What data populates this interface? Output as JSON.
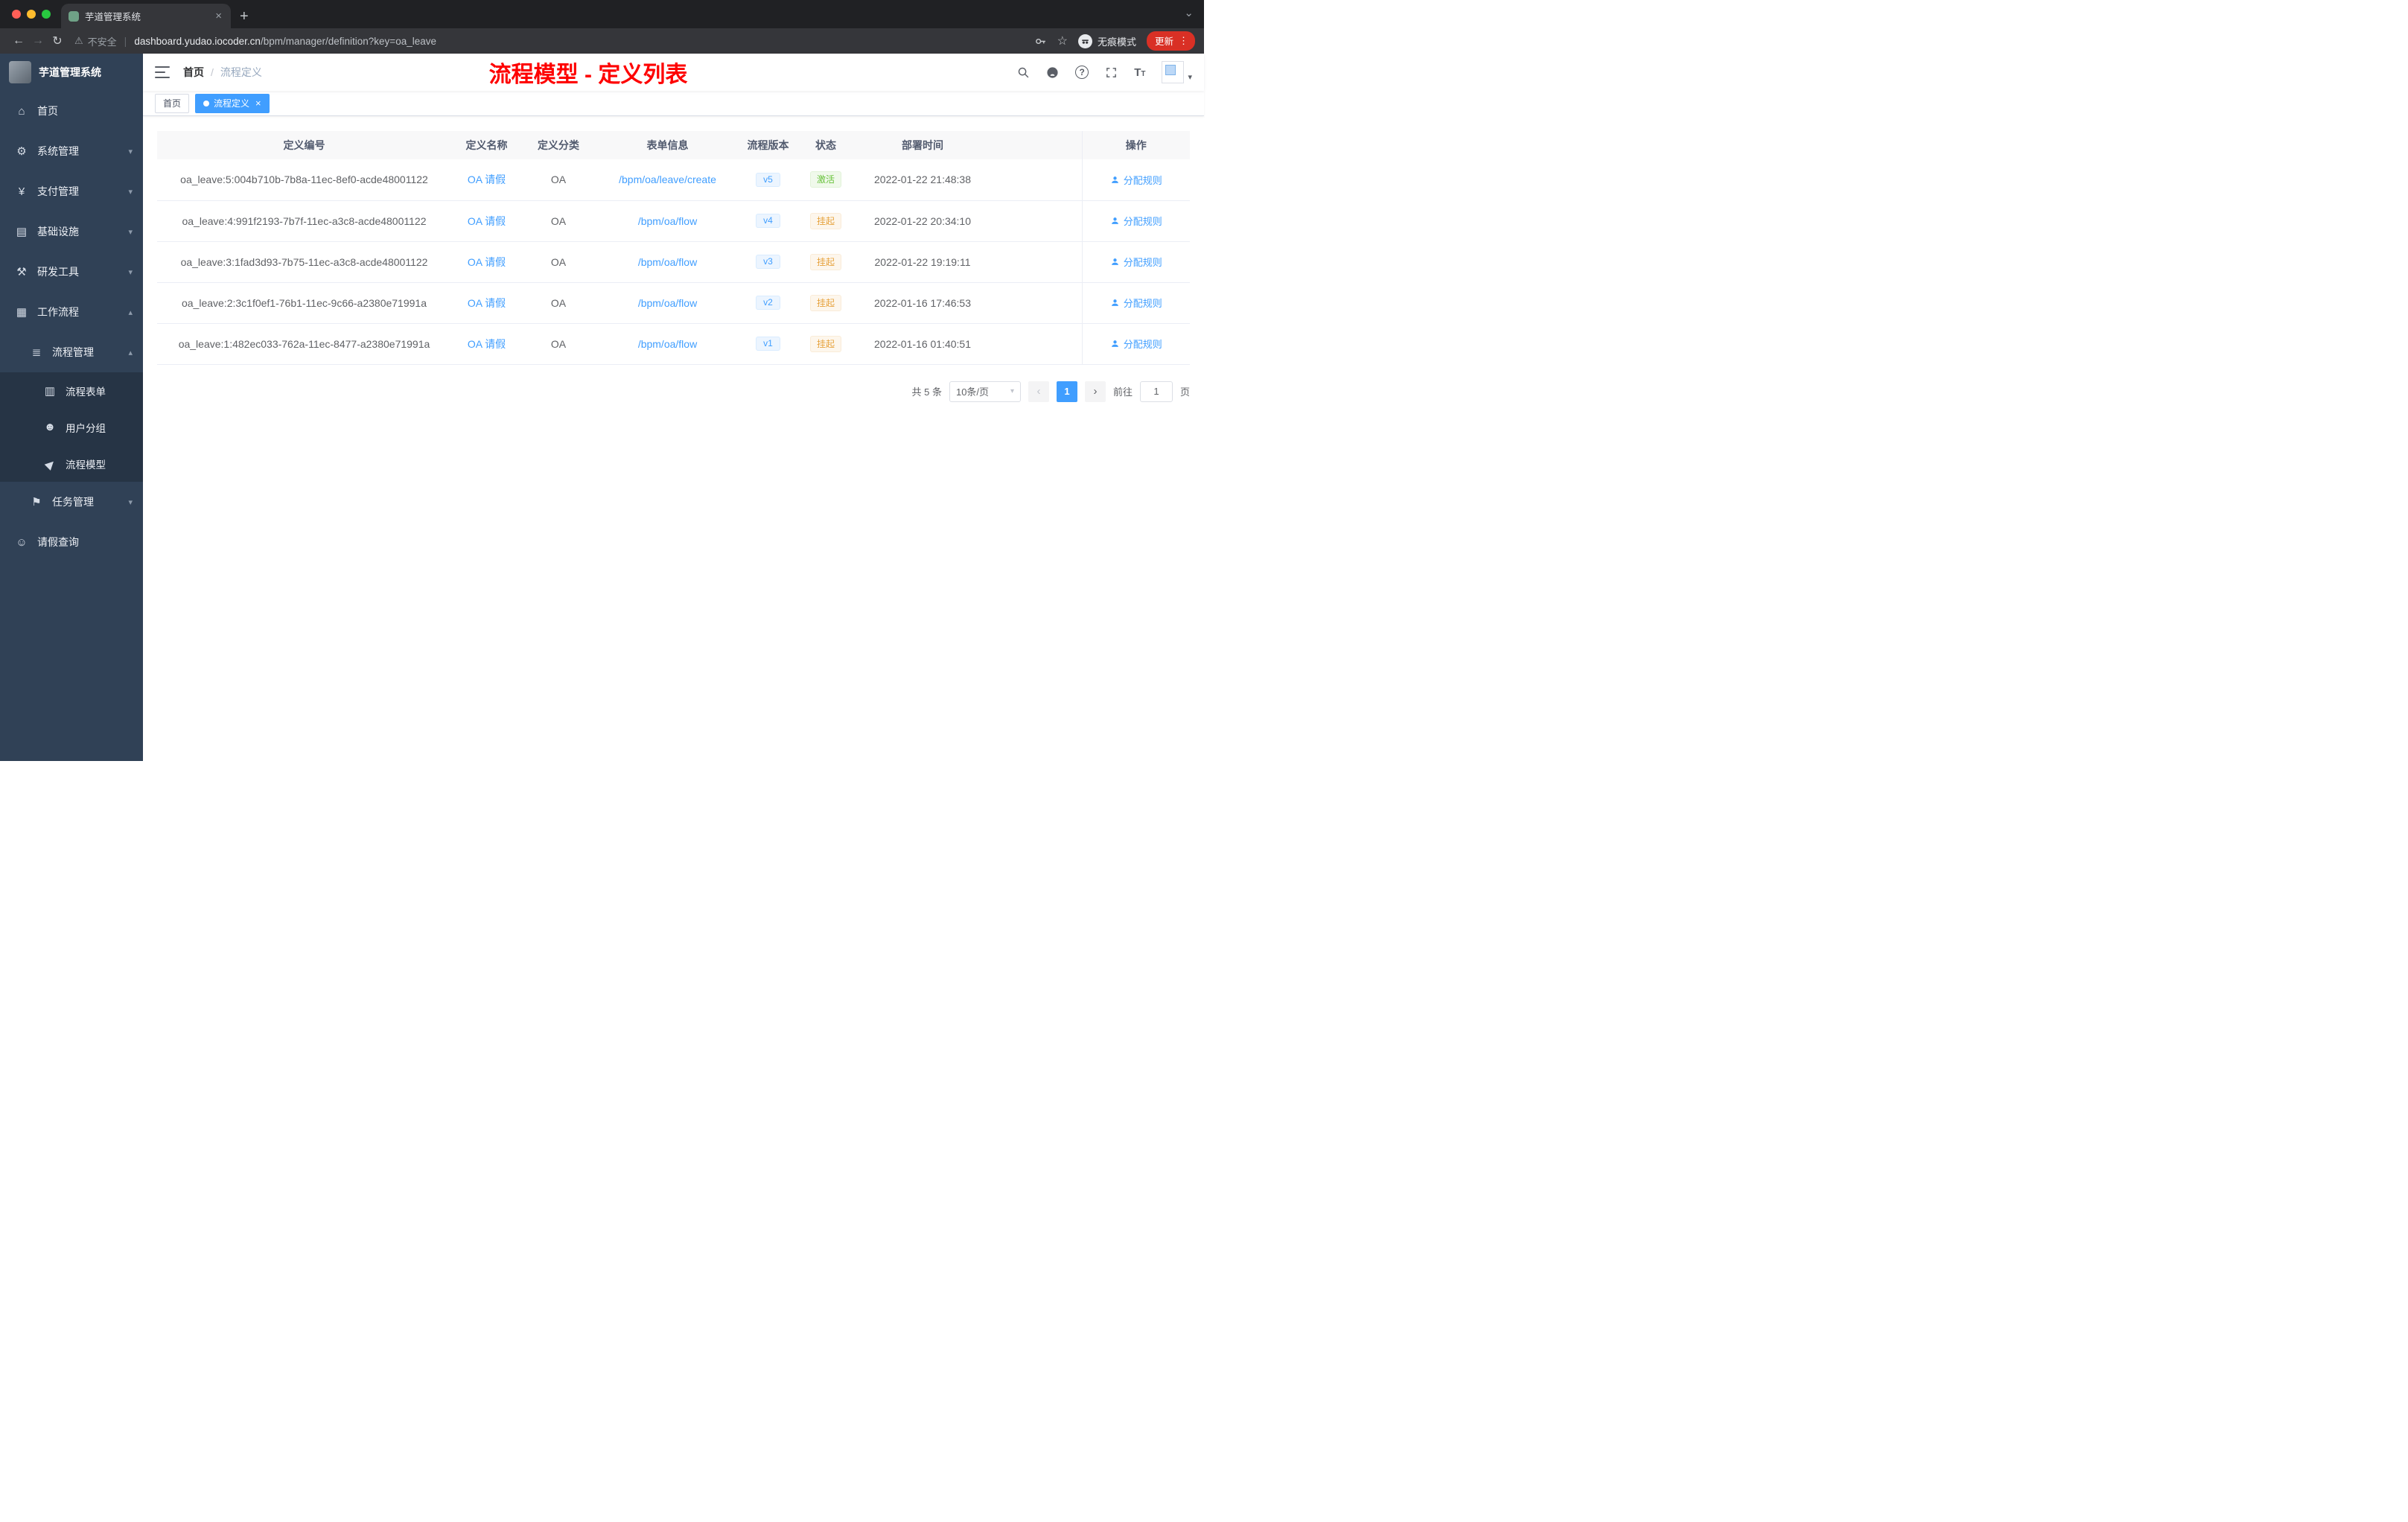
{
  "colors": {
    "accent": "#409eff",
    "success": "#67c23a",
    "warning": "#e6a23c",
    "annotation_red": "#fe0000",
    "sidebar_bg": "#304156",
    "submenu_bg": "#263445",
    "update_pill": "#d93025"
  },
  "browser": {
    "tab_title": "芋道管理系统",
    "security_label": "不安全",
    "url_domain": "dashboard.yudao.iocoder.cn",
    "url_path": "/bpm/manager/definition?key=oa_leave",
    "incognito_label": "无痕模式",
    "update_label": "更新"
  },
  "icons": {
    "tab_close": "×",
    "new_tab": "+",
    "tab_search_chevron": "⌄",
    "back": "←",
    "forward": "→",
    "reload": "↻",
    "warning": "⚠",
    "divider": "|",
    "star": "☆",
    "menu_dots": "⋮",
    "question": "?",
    "font_large": "T",
    "font_small": "T",
    "avatar_caret": "▾",
    "prev": "‹",
    "next": "›",
    "select_caret": "▾",
    "tag_close": "×"
  },
  "sidebar": {
    "logo_title": "芋道管理系统",
    "items": [
      {
        "label": "首页",
        "glyph": "⌂",
        "icon": "dashboard-icon"
      },
      {
        "label": "系统管理",
        "glyph": "⚙",
        "icon": "gear-icon"
      },
      {
        "label": "支付管理",
        "glyph": "¥",
        "icon": "yen-icon"
      },
      {
        "label": "基础设施",
        "glyph": "▤",
        "icon": "infrastructure-icon"
      },
      {
        "label": "研发工具",
        "glyph": "⚒",
        "icon": "tools-icon"
      },
      {
        "label": "工作流程",
        "glyph": "▦",
        "icon": "workflow-icon"
      },
      {
        "label": "流程管理",
        "glyph": "≣",
        "icon": "process-list-icon"
      },
      {
        "label": "流程表单",
        "glyph": "▥",
        "icon": "form-icon"
      },
      {
        "label": "用户分组",
        "glyph": "☻",
        "icon": "user-group-icon"
      },
      {
        "label": "流程模型",
        "glyph": "▶",
        "icon": "paper-plane-icon"
      },
      {
        "label": "任务管理",
        "glyph": "⚑",
        "icon": "flag-icon"
      },
      {
        "label": "请假查询",
        "glyph": "☺",
        "icon": "person-icon"
      }
    ]
  },
  "header": {
    "breadcrumb_home": "首页",
    "breadcrumb_sep": "/",
    "breadcrumb_current": "流程定义",
    "overlay_title": "流程模型 - 定义列表"
  },
  "tags": {
    "home": "首页",
    "current": "流程定义"
  },
  "table": {
    "columns": [
      "定义编号",
      "定义名称",
      "定义分类",
      "表单信息",
      "流程版本",
      "状态",
      "部署时间",
      "操作"
    ],
    "rows": [
      {
        "id": "oa_leave:5:004b710b-7b8a-11ec-8ef0-acde48001122",
        "name": "OA 请假",
        "category": "OA",
        "form": "/bpm/oa/leave/create",
        "version": "v5",
        "status": "激活",
        "status_type": "success",
        "time": "2022-01-22 21:48:38",
        "action": "分配规则"
      },
      {
        "id": "oa_leave:4:991f2193-7b7f-11ec-a3c8-acde48001122",
        "name": "OA 请假",
        "category": "OA",
        "form": "/bpm/oa/flow",
        "version": "v4",
        "status": "挂起",
        "status_type": "warning",
        "time": "2022-01-22 20:34:10",
        "action": "分配规则"
      },
      {
        "id": "oa_leave:3:1fad3d93-7b75-11ec-a3c8-acde48001122",
        "name": "OA 请假",
        "category": "OA",
        "form": "/bpm/oa/flow",
        "version": "v3",
        "status": "挂起",
        "status_type": "warning",
        "time": "2022-01-22 19:19:11",
        "action": "分配规则"
      },
      {
        "id": "oa_leave:2:3c1f0ef1-76b1-11ec-9c66-a2380e71991a",
        "name": "OA 请假",
        "category": "OA",
        "form": "/bpm/oa/flow",
        "version": "v2",
        "status": "挂起",
        "status_type": "warning",
        "time": "2022-01-16 17:46:53",
        "action": "分配规则"
      },
      {
        "id": "oa_leave:1:482ec033-762a-11ec-8477-a2380e71991a",
        "name": "OA 请假",
        "category": "OA",
        "form": "/bpm/oa/flow",
        "version": "v1",
        "status": "挂起",
        "status_type": "warning",
        "time": "2022-01-16 01:40:51",
        "action": "分配规则"
      }
    ]
  },
  "pagination": {
    "total": "共 5 条",
    "page_size": "10条/页",
    "current_page": "1",
    "goto_label": "前往",
    "goto_value": "1",
    "page_label": "页"
  }
}
